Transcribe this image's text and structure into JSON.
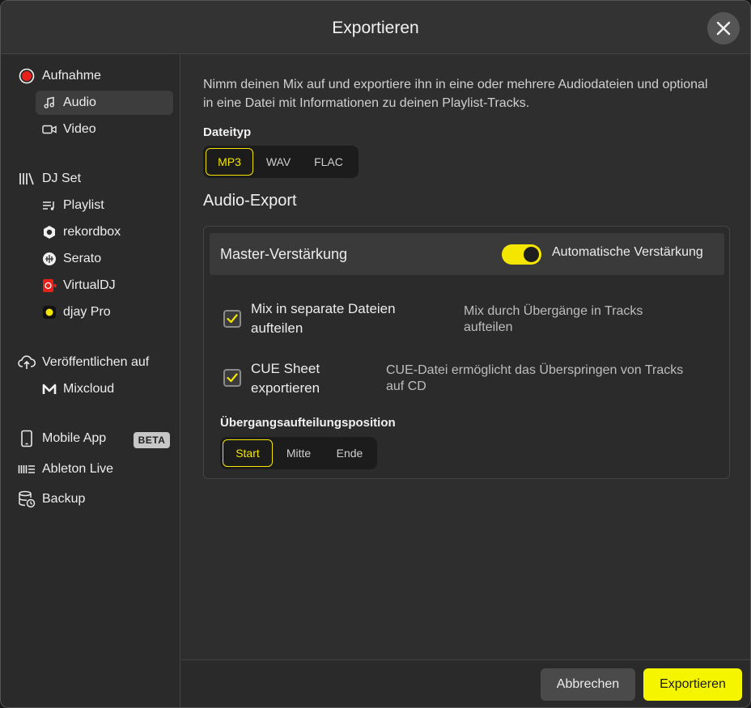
{
  "window": {
    "title": "Exportieren"
  },
  "sidebar": {
    "recording": {
      "label": "Aufnahme",
      "items": [
        {
          "label": "Audio"
        },
        {
          "label": "Video"
        }
      ]
    },
    "dj_set": {
      "label": "DJ Set",
      "items": [
        {
          "label": "Playlist"
        },
        {
          "label": "rekordbox"
        },
        {
          "label": "Serato"
        },
        {
          "label": "VirtualDJ"
        },
        {
          "label": "djay Pro"
        }
      ]
    },
    "publish": {
      "label": "Veröffentlichen auf",
      "items": [
        {
          "label": "Mixcloud"
        }
      ]
    },
    "mobile_app": {
      "label": "Mobile App",
      "badge": "BETA"
    },
    "ableton": {
      "label": "Ableton Live"
    },
    "backup": {
      "label": "Backup"
    }
  },
  "main": {
    "intro": "Nimm deinen Mix auf und exportiere ihn in eine oder mehrere Audiodateien und optional in eine Datei mit Informationen zu deinen Playlist-Tracks.",
    "file_type": {
      "label": "Dateityp",
      "options": [
        "MP3",
        "WAV",
        "FLAC"
      ],
      "selected": "MP3"
    },
    "audio_export": {
      "heading": "Audio-Export",
      "master_gain": {
        "label": "Master-Verstärkung",
        "toggle_label": "Automatische Verstärkung",
        "toggle_on": true
      },
      "split_files": {
        "label_line1": "Mix in separate Dateien",
        "label_line2": "aufteilen",
        "checked": true,
        "desc_line1": "Mix durch Übergänge in Tracks",
        "desc_line2": "aufteilen"
      },
      "cue_sheet": {
        "label_line1": "CUE Sheet",
        "label_line2": "exportieren",
        "checked": true,
        "desc_line1": "CUE-Datei ermöglicht das Überspringen von Tracks",
        "desc_line2": "auf CD"
      },
      "transition": {
        "label": "Übergangsaufteilungsposition",
        "options": [
          "Start",
          "Mitte",
          "Ende"
        ],
        "selected": "Start"
      }
    }
  },
  "footer": {
    "cancel_label": "Abbrechen",
    "export_label": "Exportieren"
  },
  "colors": {
    "accent": "#f5e600",
    "record_red": "#e8201a"
  },
  "icons": {
    "close": "close-icon",
    "record": "record-icon",
    "audio": "music-note-icon",
    "video": "video-camera-icon",
    "dj_set": "library-icon",
    "playlist": "playlist-icon",
    "rekordbox": "rekordbox-icon",
    "serato": "serato-icon",
    "virtualdj": "virtualdj-icon",
    "djay": "djay-icon",
    "publish": "cloud-upload-icon",
    "mixcloud": "mixcloud-icon",
    "mobile": "phone-icon",
    "ableton": "ableton-icon",
    "backup": "backup-icon",
    "check": "checkmark-icon"
  }
}
